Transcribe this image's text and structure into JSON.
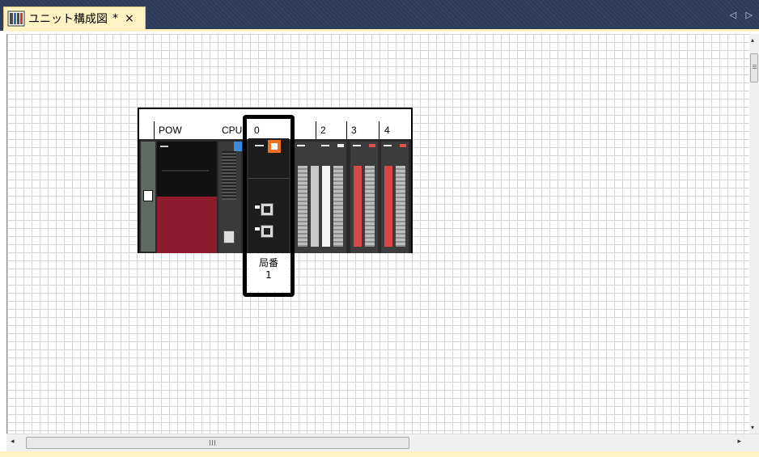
{
  "tab": {
    "title": "ユニット構成図",
    "modified_marker": "*",
    "close_glyph": "×",
    "icon": "unit-config-icon"
  },
  "tabstrip": {
    "scroll_arrows": "◁ ▷"
  },
  "diagram": {
    "slot_labels": {
      "power": "POW",
      "cpu": "CPU",
      "slot0": "0",
      "slot2": "2",
      "slot3": "3",
      "slot4": "4"
    },
    "station": {
      "label": "局番",
      "number": "1"
    }
  },
  "scrollbars": {
    "h_left": "◂",
    "h_right": "▸",
    "v_up": "▴",
    "v_down": "▾",
    "h_grip": "III"
  },
  "colors": {
    "tab_active": "#fff3c4",
    "tabstrip_bg": "#2b3a58",
    "highlight_border": "#000000",
    "power_red": "#8e1b2e",
    "status_orange": "#f07020",
    "cpu_blue": "#3b8bdc"
  }
}
